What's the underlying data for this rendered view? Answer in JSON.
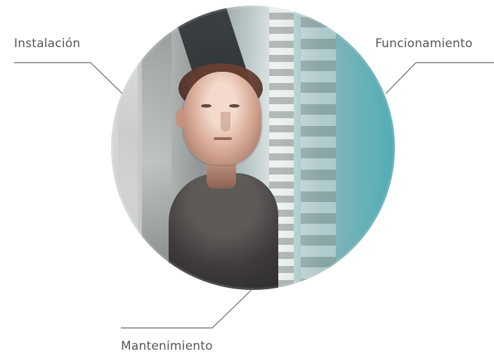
{
  "labels": {
    "installation": "Instalación",
    "operation": "Funcionamiento",
    "maintenance": "Mantenimiento"
  },
  "colors": {
    "text": "#555555",
    "line": "#666666",
    "background": "#ffffff",
    "accent": "#53aeb7"
  }
}
